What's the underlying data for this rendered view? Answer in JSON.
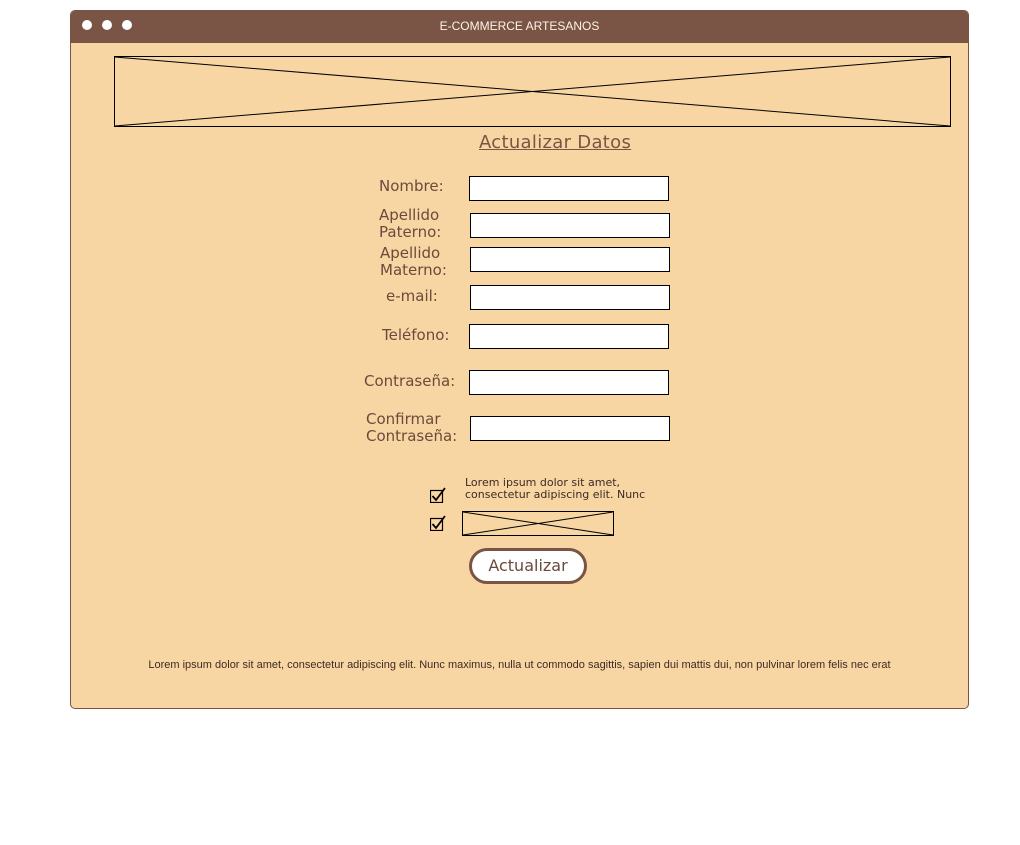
{
  "window": {
    "title": "E-COMMERCE ARTESANOS"
  },
  "form": {
    "heading": "Actualizar Datos",
    "fields": [
      {
        "label": "Nombre:"
      },
      {
        "label": "Apellido Paterno:"
      },
      {
        "label": "Apellido Materno:"
      },
      {
        "label": "e-mail:"
      },
      {
        "label": "Teléfono:"
      },
      {
        "label": "Contraseña:"
      },
      {
        "label": "Confirmar Contraseña:"
      }
    ],
    "terms_text": "Lorem ipsum dolor sit amet, consectetur adipiscing elit. Nunc",
    "submit_label": "Actualizar"
  },
  "footer": {
    "text": "Lorem ipsum dolor sit amet, consectetur adipiscing elit. Nunc maximus, nulla ut commodo sagittis, sapien dui mattis dui, non pulvinar lorem felis nec erat"
  },
  "colors": {
    "titlebar": "#7a5444",
    "background": "#f8d6a3",
    "accent": "#7a5444"
  }
}
